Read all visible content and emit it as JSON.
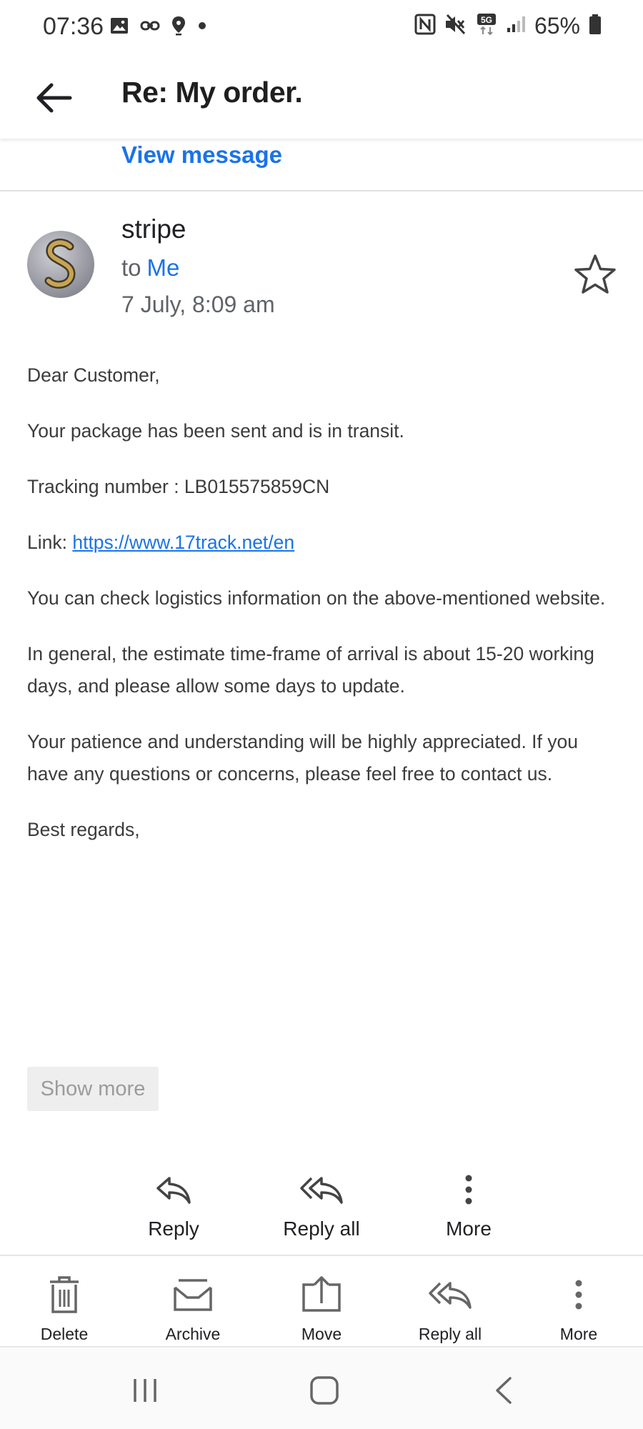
{
  "status_bar": {
    "time": "07:36",
    "battery_percent": "65%",
    "icons": [
      "image-icon",
      "link-icon",
      "location-icon",
      "dot-icon",
      "nfc-icon",
      "mute-icon",
      "5g-icon",
      "signal-icon",
      "battery-icon"
    ]
  },
  "header": {
    "back_icon": "arrow-left-icon",
    "subject": "Re: My order.",
    "view_message": "View message"
  },
  "sender": {
    "name": "stripe",
    "to_prefix": "to",
    "recipient": "Me",
    "date": "7 July, 8:09 am",
    "star_icon": "star-outline-icon"
  },
  "body": {
    "greeting": "Dear Customer,",
    "line1": "Your package has been sent and is in transit.",
    "tracking": "Tracking number : LB015575859CN",
    "link_label": "Link: ",
    "link_url": "https://www.17track.net/en",
    "line2": "You can check logistics information on the above-mentioned website.",
    "line3": "In general, the estimate time-frame of arrival is about 15-20 working days, and please allow some days to update.",
    "line4": "Your patience and understanding will be highly appreciated. If you have any questions or concerns, please feel free to contact us.",
    "signoff": "Best regards,"
  },
  "show_more": "Show more",
  "reply_actions": {
    "reply": "Reply",
    "reply_all": "Reply all",
    "more": "More"
  },
  "toolbar": {
    "delete": "Delete",
    "archive": "Archive",
    "move": "Move",
    "reply_all": "Reply all",
    "more": "More"
  },
  "colors": {
    "accent": "#1a73e8",
    "text": "#202124",
    "muted": "#5f6368"
  }
}
